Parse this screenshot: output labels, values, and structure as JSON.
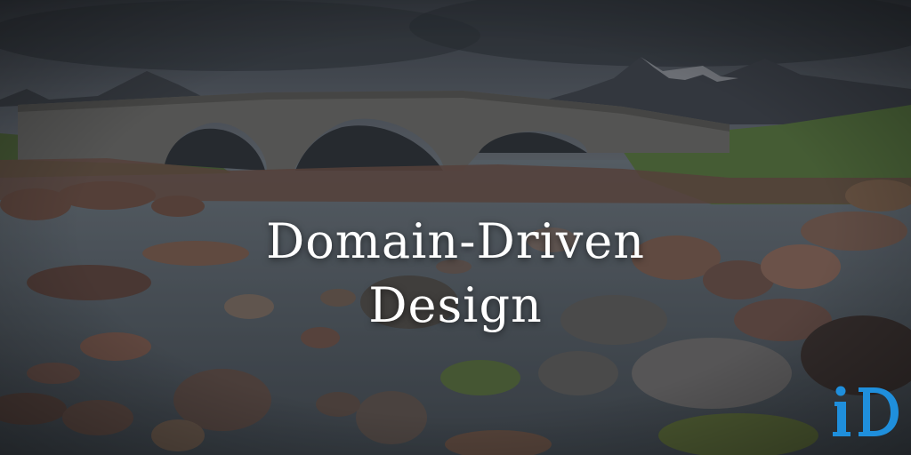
{
  "title": {
    "line1": "Domain-Driven",
    "line2": "Design"
  },
  "logo": {
    "icon": "brand-logo-icon",
    "text": "iD",
    "color": "#1f8fdc"
  },
  "colors": {
    "sky": "#4a5057",
    "mountains": "#3d4148",
    "bridge": "#6b6a66",
    "water": "#5d666e",
    "rocks": "#6a4a3e",
    "grass": "#5a7a3a"
  }
}
